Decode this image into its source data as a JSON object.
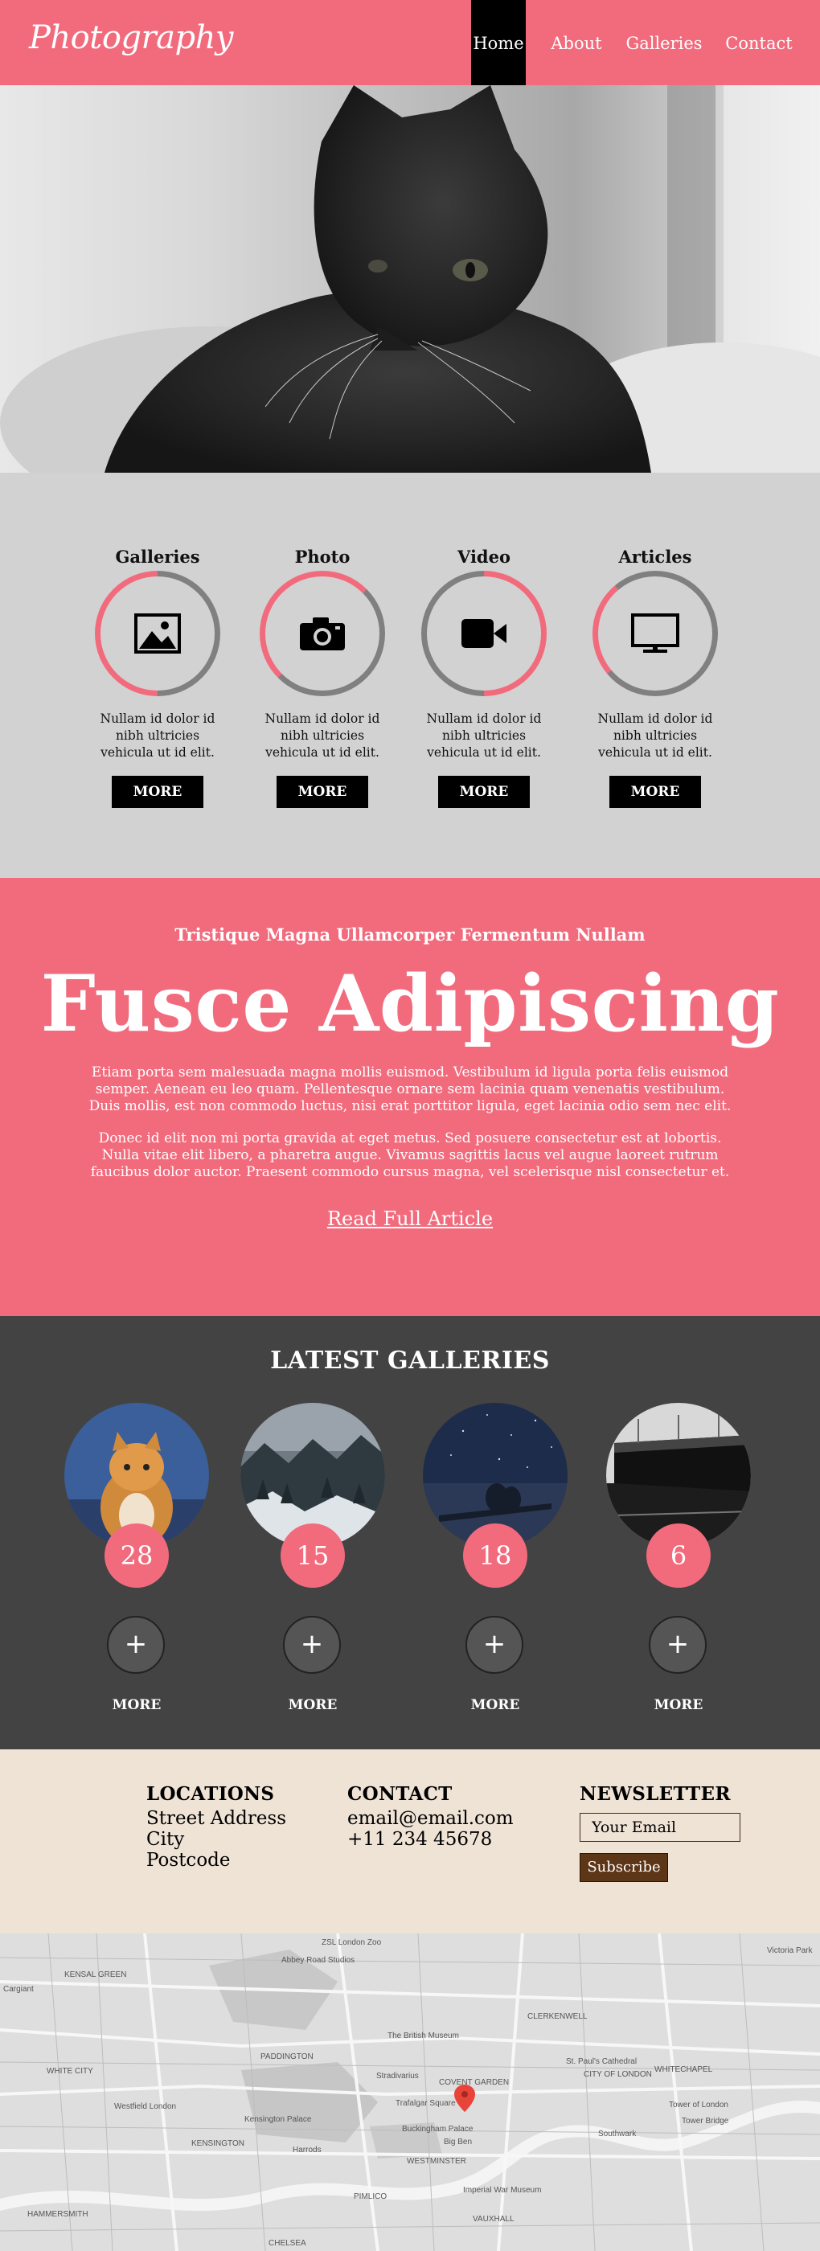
{
  "brand": {
    "logo": "Photography",
    "accent": "#f16b7d"
  },
  "nav": [
    {
      "label": "Home",
      "active": true
    },
    {
      "label": "About",
      "active": false
    },
    {
      "label": "Galleries",
      "active": false
    },
    {
      "label": "Contact",
      "active": false
    }
  ],
  "features": [
    {
      "title": "Galleries",
      "icon": "image-icon",
      "text": "Nullam id dolor id nibh ultricies vehicula ut id elit.",
      "button": "MORE"
    },
    {
      "title": "Photo",
      "icon": "camera-icon",
      "text": "Nullam id dolor id nibh ultricies vehicula ut id elit.",
      "button": "MORE"
    },
    {
      "title": "Video",
      "icon": "video-camera-icon",
      "text": "Nullam id dolor id nibh ultricies vehicula ut id elit.",
      "button": "MORE"
    },
    {
      "title": "Articles",
      "icon": "monitor-icon",
      "text": "Nullam id dolor id nibh ultricies vehicula ut id elit.",
      "button": "MORE"
    }
  ],
  "article": {
    "subtitle": "Tristique Magna Ullamcorper Fermentum Nullam",
    "title": "Fusce Adipiscing",
    "paragraph1": "Etiam porta sem malesuada magna mollis euismod. Vestibulum id ligula porta felis euismod semper. Aenean eu leo quam. Pellentesque ornare sem lacinia quam venenatis vestibulum. Duis mollis, est non commodo luctus, nisi erat porttitor ligula, eget lacinia odio sem nec elit.",
    "paragraph2": "Donec id elit non mi porta gravida at eget metus. Sed posuere consectetur est at lobortis. Nulla vitae elit libero, a pharetra augue. Vivamus sagittis lacus vel augue laoreet rutrum faucibus dolor auctor. Praesent commodo cursus magna, vel scelerisque nisl consectetur et.",
    "link": "Read Full Article"
  },
  "galleries": {
    "heading": "LATEST GALLERIES",
    "items": [
      {
        "count": "28",
        "more": "MORE"
      },
      {
        "count": "15",
        "more": "MORE"
      },
      {
        "count": "18",
        "more": "MORE"
      },
      {
        "count": "6",
        "more": "MORE"
      }
    ],
    "plus": "+"
  },
  "footer": {
    "locations": {
      "heading": "LOCATIONS",
      "lines": [
        "Street Address",
        "City",
        "Postcode"
      ]
    },
    "contact": {
      "heading": "CONTACT",
      "email": "email@email.com",
      "phone": "+11 234 45678"
    },
    "newsletter": {
      "heading": "NEWSLETTER",
      "placeholder": "Your Email",
      "button": "Subscribe"
    }
  },
  "map": {
    "labels": [
      "ZSL London Zoo",
      "Abbey Road Studios",
      "KENSAL GREEN",
      "Cargiant",
      "Victoria Park",
      "The British Museum",
      "CLERKENWELL",
      "PADDINGTON",
      "Stradivarius",
      "COVENT GARDEN",
      "St. Paul's Cathedral",
      "CITY OF LONDON",
      "WHITECHAPEL",
      "WHITE CITY",
      "Westfield London",
      "Trafalgar Square",
      "Kensington Palace",
      "Buckingham Palace",
      "Big Ben",
      "KENSINGTON",
      "Harrods",
      "Tower of London",
      "Tower Bridge",
      "Southwark",
      "WESTMINSTER",
      "PIMLICO",
      "Imperial War Museum",
      "HAMMERSMITH",
      "VAUXHALL",
      "CHELSEA"
    ]
  }
}
